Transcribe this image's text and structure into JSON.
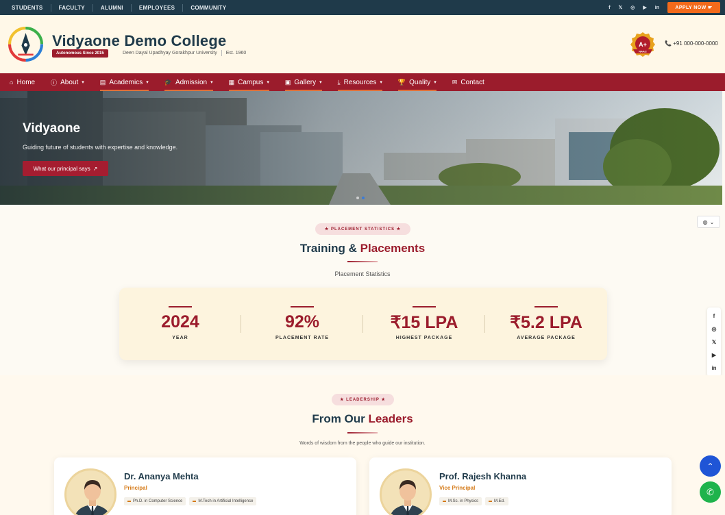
{
  "topbar": {
    "links": [
      "STUDENTS",
      "FACULTY",
      "ALUMNI",
      "EMPLOYEES",
      "COMMUNITY"
    ],
    "social": [
      "f",
      "𝕏",
      "◎",
      "▶",
      "in"
    ],
    "apply_label": "APPLY NOW ☛"
  },
  "brand": {
    "name": "Vidyaone Demo College",
    "badge": "Autonomous Since 2015",
    "university": "Deen Dayal Upadhyay Gorakhpur University",
    "established": "Est. 1960",
    "naac_grade": "A+",
    "naac_label": "NAAC",
    "phone": "+91 000-000-0000"
  },
  "nav": {
    "items": [
      {
        "label": "Home",
        "icon": "home-icon"
      },
      {
        "label": "About",
        "icon": "info-icon"
      },
      {
        "label": "Academics",
        "icon": "book-icon"
      },
      {
        "label": "Admission",
        "icon": "graduation-cap-icon"
      },
      {
        "label": "Campus",
        "icon": "building-icon"
      },
      {
        "label": "Gallery",
        "icon": "images-icon"
      },
      {
        "label": "Resources",
        "icon": "download-icon"
      },
      {
        "label": "Quality",
        "icon": "trophy-icon"
      },
      {
        "label": "Contact",
        "icon": "envelope-icon"
      }
    ]
  },
  "hero": {
    "title": "Vidyaone",
    "subtitle": "Guiding future of students with expertise and knowledge.",
    "button_label": "What our principal says"
  },
  "placement": {
    "pill": "PLACEMENT STATISTICS",
    "title_main": "Training & ",
    "title_highlight": "Placements",
    "subtitle": "Placement Statistics",
    "stats": [
      {
        "value": "2024",
        "label": "YEAR"
      },
      {
        "value": "92%",
        "label": "PLACEMENT RATE"
      },
      {
        "value": "₹15 LPA",
        "label": "HIGHEST PACKAGE"
      },
      {
        "value": "₹5.2 LPA",
        "label": "AVERAGE PACKAGE"
      }
    ]
  },
  "leadership": {
    "pill": "LEADERSHIP",
    "title_main": "From Our ",
    "title_highlight": "Leaders",
    "subtitle": "Words of wisdom from the people who guide our institution.",
    "leaders": [
      {
        "name": "Dr. Ananya Mehta",
        "role": "Principal",
        "tags": [
          "Ph.D. in Computer Science",
          "M.Tech in Artificial Intelligence"
        ]
      },
      {
        "name": "Prof. Rajesh Khanna",
        "role": "Vice Principal",
        "tags": [
          "M.Sc. in Physics",
          "M.Ed."
        ]
      }
    ]
  },
  "side_social": [
    "f",
    "◎",
    "𝕏",
    "▶",
    "in"
  ],
  "colors": {
    "primary": "#9b1c2c",
    "navy": "#1f3a4a",
    "accent": "#f26a1b"
  }
}
